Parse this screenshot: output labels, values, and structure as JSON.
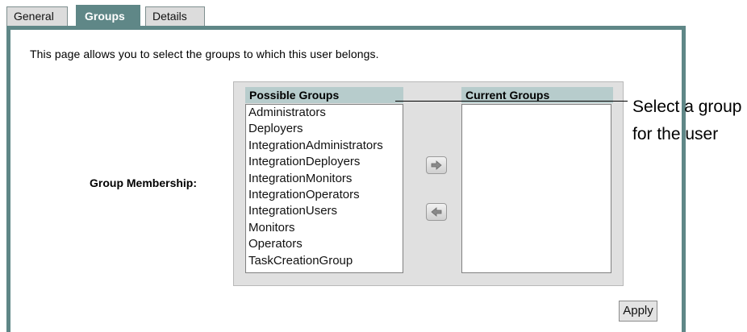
{
  "tabs": [
    {
      "label": "General",
      "active": false
    },
    {
      "label": "Groups",
      "active": true
    },
    {
      "label": "Details",
      "active": false
    }
  ],
  "intro_text": "This page allows you to select the groups to which this user belongs.",
  "group_membership": {
    "label": "Group Membership:",
    "possible_header": "Possible Groups",
    "current_header": "Current Groups",
    "possible_groups": [
      "Administrators",
      "Deployers",
      "IntegrationAdministrators",
      "IntegrationDeployers",
      "IntegrationMonitors",
      "IntegrationOperators",
      "IntegrationUsers",
      "Monitors",
      "Operators",
      "TaskCreationGroup"
    ],
    "current_groups": [],
    "add_icon": "arrow-right-icon",
    "remove_icon": "arrow-left-icon"
  },
  "apply_label": "Apply",
  "callout": {
    "line1": "Select a group",
    "line2": "for the user"
  },
  "colors": {
    "accent": "#5f8787",
    "header_bg": "#b7cccc",
    "box_bg": "#e0e0e0"
  }
}
